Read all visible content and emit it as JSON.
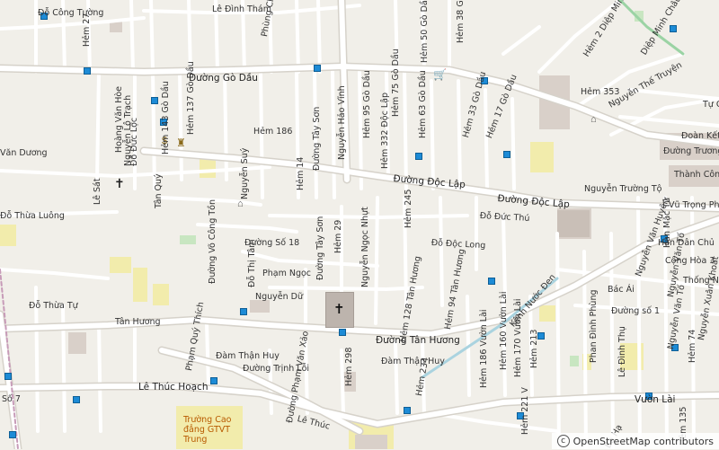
{
  "map": {
    "streets": {
      "do_cong_tuong": "Đỗ Công Tường",
      "le_dinh_tham": "Lê Đình Thám",
      "phung_chi": "Phùng Chí",
      "hem_27": "Hẻm 27",
      "hem_38_go": "Hẻm 38 Gò",
      "hem_50_go_dau": "Hẻm 50 Gò Dầu",
      "hem_2_diep_minh": "Hẻm 2 Diệp Minh",
      "diep_minh_chau": "Diệp Minh Châu",
      "duong_go_dau": "Đường Gò Dầu",
      "hoang_van_hoe": "Hoàng Văn Hòe",
      "nguyen_lo_trach": "Nguyễn Lộ Trạch",
      "do_duc_loc": "Đỗ Đức Lộc",
      "hem_143_go_dau": "Hẻm 143 Gò Dầu",
      "hem_137_go_dau": "Hẻm 137 Gò Dầu",
      "hem_186": "Hẻm 186",
      "duong_tay_son": "Đường Tây Sơn",
      "nguyen_hao_vinh": "Nguyễn Hảo Vĩnh",
      "hem_95_go_dau": "Hẻm 95 Gò Dầu",
      "hem_75_go_dau": "Hẻm 75 Gò Dầu",
      "hem_332_doc_lap": "Hẻm 332 Độc Lập",
      "hem_63_go_dau": "Hẻm 63 Gò Dầu",
      "hem_33_go_dau": "Hẻm 33 Gò Dầu",
      "hem_17_go_dau": "Hẻm 17 Gò Dầu",
      "hem_353": "Hẻm 353",
      "nguyen_the_truyen": "Nguyễn Thế Truyện",
      "tu_q": "Tự Q",
      "doan_ket": "Đoàn Kết",
      "duong_truong": "Đường Trương",
      "thanh_cong": "Thành Công",
      "nguyen_truong_to": "Nguyễn Trường Tộ",
      "vu_trong_phu": "Vũ Trọng Phụ",
      "duong_doc_lap": "Đường Độc Lập",
      "duong_doc_lap_2": "Đường Độc Lập",
      "le_sat": "Lê Sát",
      "tan_quy": "Tân Quý",
      "van_duong": "Văn Dương",
      "nguyen_suy": "Nguyễn Suý",
      "hem_14": "Hẻm 14",
      "hem_245": "Hẻm 245",
      "do_duc_thu": "Đỗ Đức Thú",
      "do_thua_luong": "Đỗ Thừa Luông",
      "duong_vo_cong_ton": "Đường Võ Công Tồn",
      "duong_so_18": "Đường Số 18",
      "hem_29": "Hẻm 29",
      "nguyen_ngoc_nhut": "Nguyễn Ngọc Nhựt",
      "do_doc_long": "Đỗ Độc Long",
      "han_mac_tu": "Hàn Mặc Tử",
      "han_dan_chu": "Hàn Dân Chủ",
      "cong_hoa_3": "Cộng Hòa 3",
      "thong_nh": "Thống Nh",
      "do_thi_tam": "Đỗ Thị Tâm",
      "pham_ngoc": "Phạm Ngọc",
      "duong_tay_son_2": "Đường Tây Sơn",
      "hem_128_tan_huong": "Hẻm 128 Tân Hương",
      "hem_94_tan_huong": "Hẻm 94 Tân Hương",
      "kenh_nuoc_den": "Kênh Nước Đen",
      "nguyen_van_huyen": "Nguyễn Văn Huyên",
      "bac_ai": "Bác Ái",
      "nguyen_van_to": "Nguyễn Văn Tố",
      "nguyen_du": "Nguyễn Dữ",
      "do_thua_tu": "Đỗ Thừa Tự",
      "tan_huong": "Tân Hương",
      "pham_quy_thich": "Phạm Quý Thích",
      "duong_tan_huong": "Đường Tân Hương",
      "phan_dinh_phung": "Phan Đình Phùng",
      "duong_so_1": "Đường số 1",
      "nguyen_van_to_2": "Nguyễn Văn Tố",
      "nguyen_xuan_khoat": "Nguyễn Xuân Khoát",
      "dam_than_huy": "Đàm Thận Huy",
      "dam_than_huy_2": "Đàm Thận Huy",
      "duong_trinh_loi": "Đường Trịnh Lỗi",
      "duong_pham_van_xao": "Đường Phạm Văn Xảo",
      "hem_298": "Hẻm 298",
      "hem_234": "Hẻm 234",
      "hem_186_vuon_lai": "Hẻm 186 Vườn Lài",
      "hem_170_vuon_lai": "Hẻm 170 Vườn Lài",
      "hem_160_vuon_lai": "Hẻm 160 Vườn Lài",
      "hem_213": "Hẻm 213",
      "le_dinh_thu": "Lê Đình Thụ",
      "hem_74": "Hẻm 74",
      "le_thuc_hoach": "Lê Thúc Hoạch",
      "vuon_lai": "Vườn Lài",
      "so_7": "Số 7",
      "hem_221_v": "Hẻm 221 V",
      "ba_ha": "Bà Hạ",
      "le_thuc_2": "Lê Thúc",
      "hem_135": "Hẻm 135"
    },
    "pois": {
      "school": "Trường Cao đẳng GTVT Trung"
    },
    "attribution": "OpenStreetMap contributors",
    "colors": {
      "background": "#f1efe9",
      "road": "#ffffff",
      "road_casing": "#d6d2ca",
      "landuse_yellow": "#f2ecac",
      "building": "#d9d0c9",
      "green": "#c8e6c1",
      "bus_stop": "#1d8bd6",
      "shop": "#b7459e"
    }
  }
}
